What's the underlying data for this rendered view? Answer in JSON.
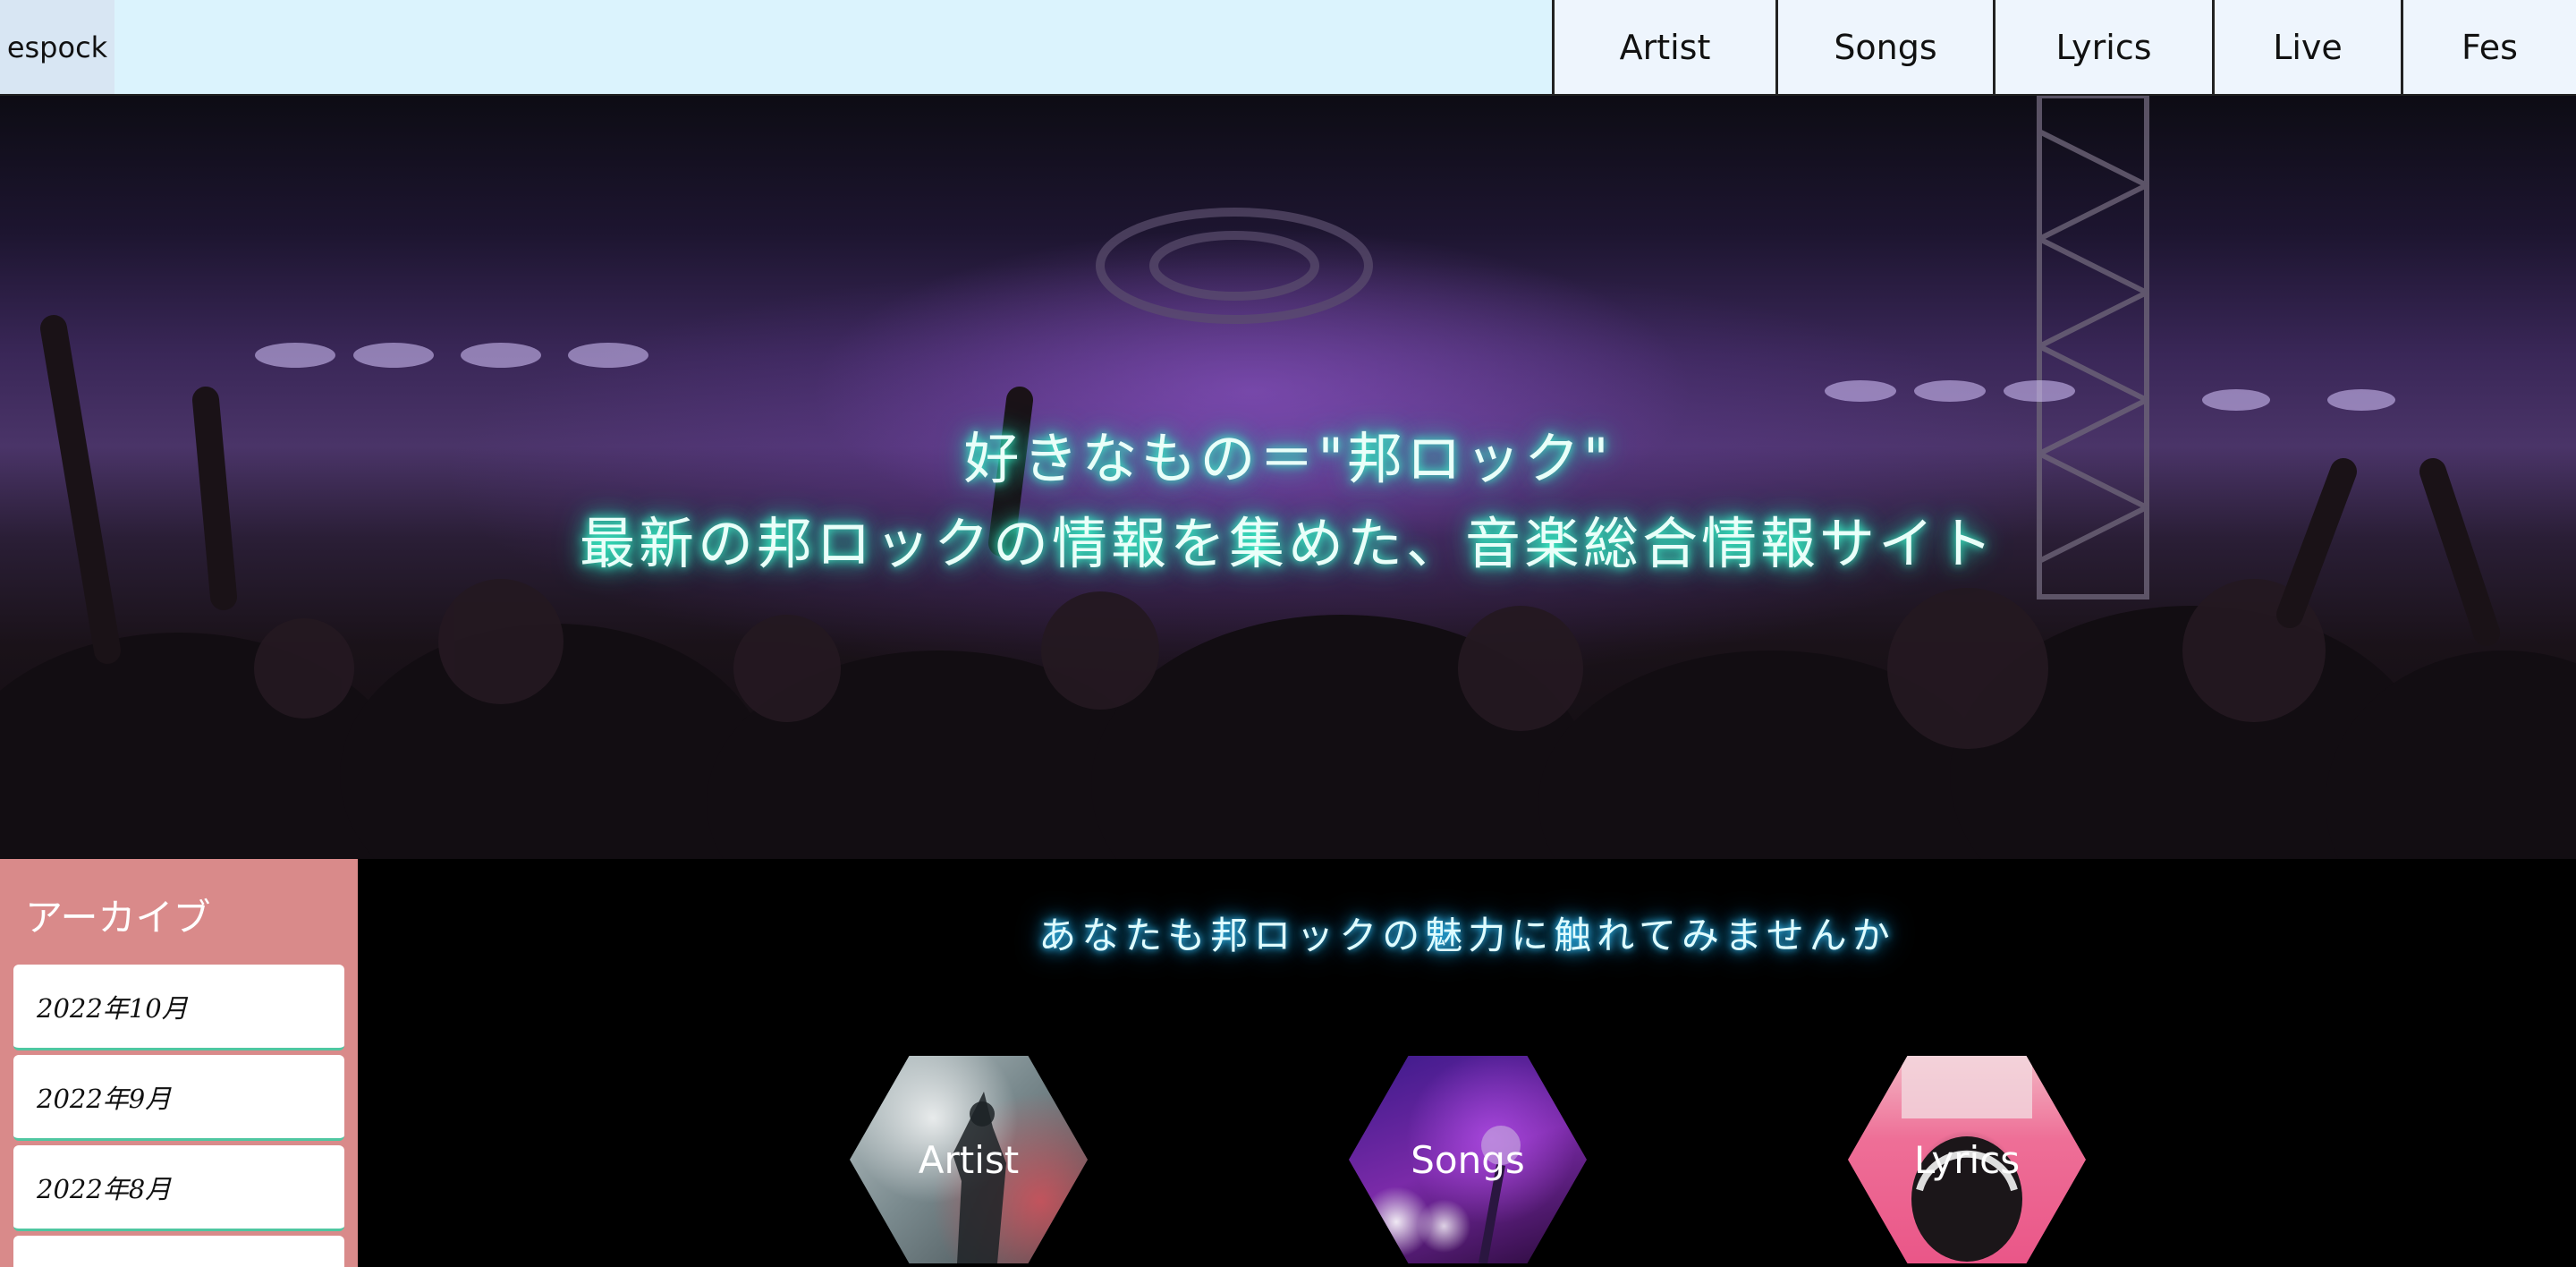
{
  "header": {
    "logo": "espock",
    "nav": [
      {
        "label": "Artist"
      },
      {
        "label": "Songs"
      },
      {
        "label": "Lyrics"
      },
      {
        "label": "Live"
      },
      {
        "label": "Fes"
      }
    ]
  },
  "hero": {
    "line1": "好きなもの＝\"邦ロック\"",
    "line2": "最新の邦ロックの情報を集めた、音楽総合情報サイト"
  },
  "sidebar": {
    "title": "アーカイブ",
    "items": [
      {
        "label": "2022年10月"
      },
      {
        "label": "2022年9月"
      },
      {
        "label": "2022年8月"
      }
    ]
  },
  "main": {
    "heading": "あなたも邦ロックの魅力に触れてみませんか",
    "categories": [
      {
        "label": "Artist"
      },
      {
        "label": "Songs"
      },
      {
        "label": "Lyrics"
      }
    ]
  },
  "colors": {
    "header_bg": "#dbf3fd",
    "nav_bg": "#eef5fd",
    "sidebar_bg": "#d98a8a",
    "hero_glow": "#3dffd0",
    "heading_glow": "#37c7ff"
  }
}
